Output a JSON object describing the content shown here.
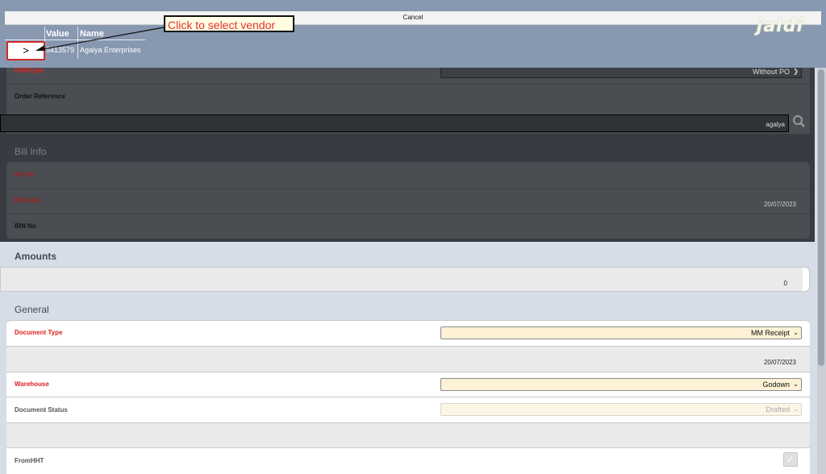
{
  "picker": {
    "cancel_label": "Cancel",
    "logo": "jaldi",
    "columns": [
      "Value",
      "Name"
    ],
    "select_label": ">",
    "rows": [
      {
        "value": "5413579",
        "name": "Agalya Enterprises"
      }
    ]
  },
  "tooltip": {
    "text": "Click to select vendor"
  },
  "form": {
    "grn_type_label": "GRNType",
    "grn_type_value": "Without PO",
    "order_ref_label": "Order Reference",
    "vendor_search_value": "agalya"
  },
  "bill_info": {
    "title": "Bill Info",
    "bill_no_label": "Bill No",
    "bill_date_label": "Bill Date",
    "bill_date_value": "20/07/2023",
    "irn_label": "IRN No"
  },
  "amounts": {
    "title": "Amounts",
    "value": "0"
  },
  "general": {
    "title": "General",
    "doc_type_label": "Document Type",
    "doc_type_value": "MM Receipt",
    "date_value": "20/07/2023",
    "warehouse_label": "Warehouse",
    "warehouse_value": "Godown",
    "doc_status_label": "Document Status",
    "doc_status_value": "Drafted",
    "from_hht_label": "FromHHT"
  },
  "colors": {
    "required": "#e02020",
    "accent_field": "#fdf1d6",
    "header_band": "#8798b0"
  }
}
